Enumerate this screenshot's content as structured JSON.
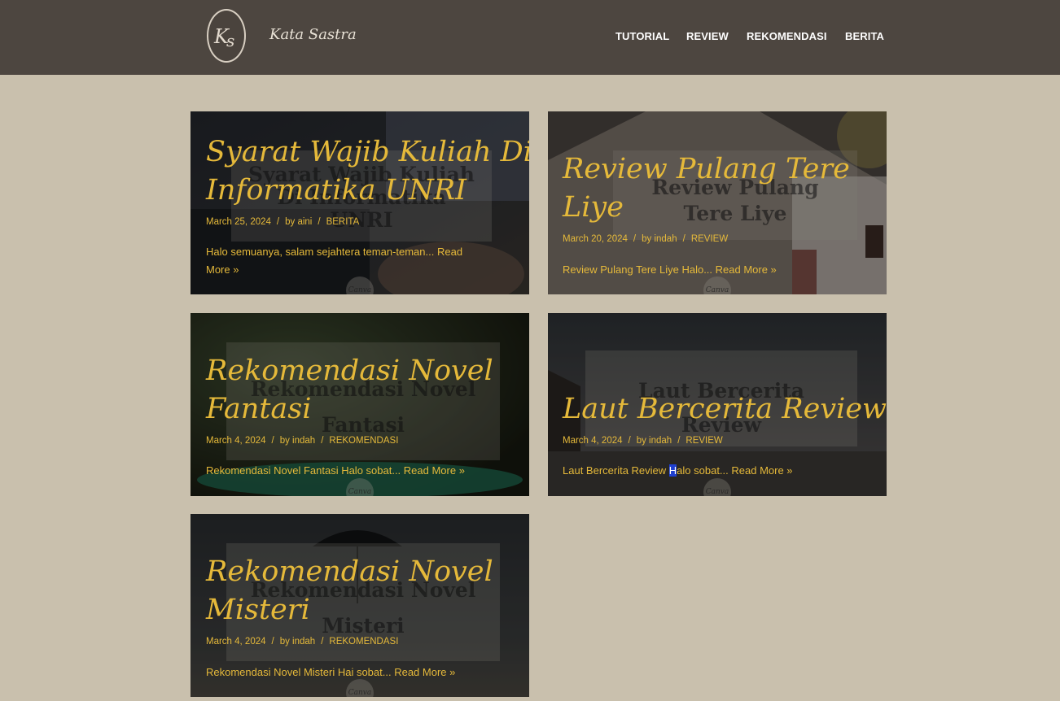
{
  "site": {
    "name": "Kata Sastra",
    "logo_text": "Ks"
  },
  "nav": [
    "TUTORIAL",
    "REVIEW",
    "REKOMENDASI",
    "BERITA"
  ],
  "posts": [
    {
      "title_lines": [
        "Syarat Wajib Kuliah Di",
        "Informatika UNRI"
      ],
      "date": "March 25, 2024",
      "author": "by aini",
      "category": "BERITA",
      "excerpt_lines": [
        "Halo semuanya, salam sejahtera teman-teman... Read",
        "More »"
      ],
      "image_text": [
        "Syarat Wajib Kuliah",
        "Di Informatika",
        "UNRI"
      ],
      "watermark": "Canva"
    },
    {
      "title_lines": [
        "Review Pulang Tere",
        "Liye"
      ],
      "date": "March 20, 2024",
      "author": "by indah",
      "category": "REVIEW",
      "excerpt_lines": [
        "Review Pulang Tere Liye Halo... Read More »"
      ],
      "image_text": [
        "Review Pulang",
        "Tere Liye"
      ],
      "watermark": "Canva"
    },
    {
      "title_lines": [
        "Rekomendasi Novel",
        "Fantasi"
      ],
      "date": "March 4, 2024",
      "author": "by indah",
      "category": "REKOMENDASI",
      "excerpt_lines": [
        "Rekomendasi Novel Fantasi Halo sobat... Read More »"
      ],
      "image_text": [
        "Rekomendasi Novel",
        "Fantasi"
      ],
      "watermark": "Canva"
    },
    {
      "title_lines": [
        "Laut Bercerita Review"
      ],
      "date": "March 4, 2024",
      "author": "by indah",
      "category": "REVIEW",
      "excerpt_pre": "Laut Bercerita Review ",
      "excerpt_hl": "H",
      "excerpt_post": "alo sobat... Read More »",
      "image_text": [
        "Laut Bercerita",
        "Review"
      ],
      "watermark": "Canva"
    },
    {
      "title_lines": [
        "Rekomendasi Novel",
        "Misteri"
      ],
      "date": "March 4, 2024",
      "author": "by indah",
      "category": "REKOMENDASI",
      "excerpt_lines": [
        "Rekomendasi Novel Misteri Hai sobat... Read More »"
      ],
      "image_text": [
        "Rekomendasi Novel",
        "Misteri"
      ],
      "watermark": "Canva"
    }
  ],
  "meta_separator": "/",
  "colors": {
    "header_bg": "#4d4640",
    "page_bg": "#c9c0ad",
    "accent": "#e5b93a"
  }
}
